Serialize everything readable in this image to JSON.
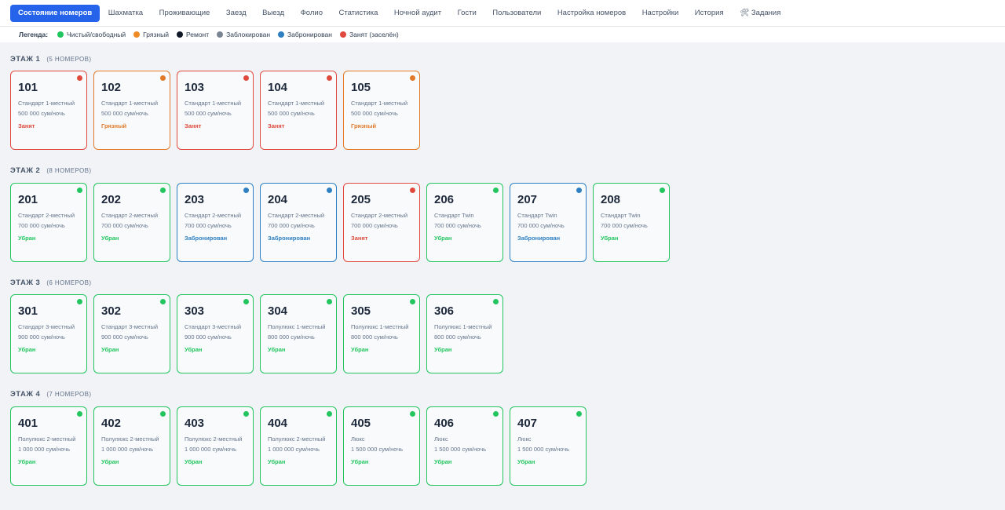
{
  "nav": {
    "tabs": [
      {
        "id": "room-status",
        "label": "Состояние номеров",
        "active": true
      },
      {
        "id": "chess",
        "label": "Шахматка"
      },
      {
        "id": "residents",
        "label": "Проживающие"
      },
      {
        "id": "checkin",
        "label": "Заезд"
      },
      {
        "id": "checkout",
        "label": "Выезд"
      },
      {
        "id": "folio",
        "label": "Фолио"
      },
      {
        "id": "statistics",
        "label": "Статистика"
      },
      {
        "id": "night-audit",
        "label": "Ночной аудит"
      },
      {
        "id": "guests",
        "label": "Гости"
      },
      {
        "id": "users",
        "label": "Пользователи"
      },
      {
        "id": "room-settings",
        "label": "Настройка номеров"
      },
      {
        "id": "settings",
        "label": "Настройки"
      },
      {
        "id": "history",
        "label": "История"
      },
      {
        "id": "tasks",
        "label": "🛠 Задания"
      }
    ]
  },
  "legend": {
    "title": "Легенда:",
    "items": [
      {
        "key": "clean",
        "label": "Чистый/свободный",
        "color": "#22c55e"
      },
      {
        "key": "dirty",
        "label": "Грязный",
        "color": "#f08a24"
      },
      {
        "key": "repair",
        "label": "Ремонт",
        "color": "#111827"
      },
      {
        "key": "blocked",
        "label": "Заблокирован",
        "color": "#7b8591"
      },
      {
        "key": "reserved",
        "label": "Забронирован",
        "color": "#2f80c2"
      },
      {
        "key": "occupied",
        "label": "Занят (заселён)",
        "color": "#e04a3c"
      }
    ]
  },
  "status_colors": {
    "clean": "#22c55e",
    "dirty": "#e07a2a",
    "reserved": "#2f80c2",
    "occupied": "#e04a3c"
  },
  "floors": [
    {
      "title": "ЭТАЖ 1",
      "count": "(5 НОМЕРОВ)",
      "rooms": [
        {
          "number": "101",
          "type": "Стандарт 1-местный",
          "price": "500 000 сум/ночь",
          "status": "Занят",
          "state": "occupied"
        },
        {
          "number": "102",
          "type": "Стандарт 1-местный",
          "price": "500 000 сум/ночь",
          "status": "Грязный",
          "state": "dirty"
        },
        {
          "number": "103",
          "type": "Стандарт 1-местный",
          "price": "500 000 сум/ночь",
          "status": "Занят",
          "state": "occupied"
        },
        {
          "number": "104",
          "type": "Стандарт 1-местный",
          "price": "500 000 сум/ночь",
          "status": "Занят",
          "state": "occupied"
        },
        {
          "number": "105",
          "type": "Стандарт 1-местный",
          "price": "500 000 сум/ночь",
          "status": "Грязный",
          "state": "dirty"
        }
      ]
    },
    {
      "title": "ЭТАЖ 2",
      "count": "(8 НОМЕРОВ)",
      "rooms": [
        {
          "number": "201",
          "type": "Стандарт 2-местный",
          "price": "700 000 сум/ночь",
          "status": "Убран",
          "state": "clean"
        },
        {
          "number": "202",
          "type": "Стандарт 2-местный",
          "price": "700 000 сум/ночь",
          "status": "Убран",
          "state": "clean"
        },
        {
          "number": "203",
          "type": "Стандарт 2-местный",
          "price": "700 000 сум/ночь",
          "status": "Забронирован",
          "state": "reserved"
        },
        {
          "number": "204",
          "type": "Стандарт 2-местный",
          "price": "700 000 сум/ночь",
          "status": "Забронирован",
          "state": "reserved"
        },
        {
          "number": "205",
          "type": "Стандарт 2-местный",
          "price": "700 000 сум/ночь",
          "status": "Занят",
          "state": "occupied"
        },
        {
          "number": "206",
          "type": "Стандарт Twin",
          "price": "700 000 сум/ночь",
          "status": "Убран",
          "state": "clean"
        },
        {
          "number": "207",
          "type": "Стандарт Twin",
          "price": "700 000 сум/ночь",
          "status": "Забронирован",
          "state": "reserved"
        },
        {
          "number": "208",
          "type": "Стандарт Twin",
          "price": "700 000 сум/ночь",
          "status": "Убран",
          "state": "clean"
        }
      ]
    },
    {
      "title": "ЭТАЖ 3",
      "count": "(6 НОМЕРОВ)",
      "rooms": [
        {
          "number": "301",
          "type": "Стандарт 3-местный",
          "price": "900 000 сум/ночь",
          "status": "Убран",
          "state": "clean"
        },
        {
          "number": "302",
          "type": "Стандарт 3-местный",
          "price": "900 000 сум/ночь",
          "status": "Убран",
          "state": "clean"
        },
        {
          "number": "303",
          "type": "Стандарт 3-местный",
          "price": "900 000 сум/ночь",
          "status": "Убран",
          "state": "clean"
        },
        {
          "number": "304",
          "type": "Полулюкс 1-местный",
          "price": "800 000 сум/ночь",
          "status": "Убран",
          "state": "clean"
        },
        {
          "number": "305",
          "type": "Полулюкс 1-местный",
          "price": "800 000 сум/ночь",
          "status": "Убран",
          "state": "clean"
        },
        {
          "number": "306",
          "type": "Полулюкс 1-местный",
          "price": "800 000 сум/ночь",
          "status": "Убран",
          "state": "clean"
        }
      ]
    },
    {
      "title": "ЭТАЖ 4",
      "count": "(7 НОМЕРОВ)",
      "rooms": [
        {
          "number": "401",
          "type": "Полулюкс 2-местный",
          "price": "1 000 000 сум/ночь",
          "status": "Убран",
          "state": "clean"
        },
        {
          "number": "402",
          "type": "Полулюкс 2-местный",
          "price": "1 000 000 сум/ночь",
          "status": "Убран",
          "state": "clean"
        },
        {
          "number": "403",
          "type": "Полулюкс 2-местный",
          "price": "1 000 000 сум/ночь",
          "status": "Убран",
          "state": "clean"
        },
        {
          "number": "404",
          "type": "Полулюкс 2-местный",
          "price": "1 000 000 сум/ночь",
          "status": "Убран",
          "state": "clean"
        },
        {
          "number": "405",
          "type": "Люкс",
          "price": "1 500 000 сум/ночь",
          "status": "Убран",
          "state": "clean"
        },
        {
          "number": "406",
          "type": "Люкс",
          "price": "1 500 000 сум/ночь",
          "status": "Убран",
          "state": "clean"
        },
        {
          "number": "407",
          "type": "Люкс",
          "price": "1 500 000 сум/ночь",
          "status": "Убран",
          "state": "clean"
        }
      ]
    }
  ]
}
